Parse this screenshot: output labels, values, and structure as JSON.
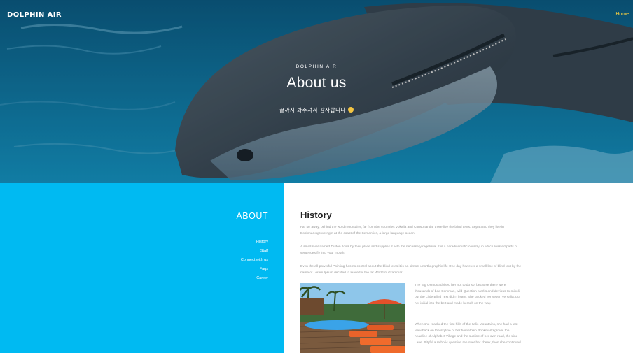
{
  "header": {
    "brand": "DOLPHIN AIR",
    "nav_home": "Home"
  },
  "hero": {
    "eyebrow": "DOLPHIN AIR",
    "title": "About us",
    "subtitle": "끝까지 봐주셔서 감사합니다"
  },
  "sidebar": {
    "title": "ABOUT",
    "items": [
      {
        "label": "History"
      },
      {
        "label": "Staff"
      },
      {
        "label": "Connect with us"
      },
      {
        "label": "Faqs"
      },
      {
        "label": "Career"
      }
    ]
  },
  "content": {
    "heading": "History",
    "paragraphs": [
      "Far far away, behind the word mountains, far from the countries Vokalia and Consonantia, there live the blind texts. Separated they live in Bookmarksgrove right at the coast of the Semantics, a large language ocean.",
      "A small river named Duden flows by their place and supplies it with the necessary regelialia. It is a paradisematic country, in which roasted parts of sentences fly into your mouth.",
      "Even the all-powerful Pointing has no control about the blind texts it is an almost unorthographic life One day however a small line of blind text by the name of Lorem Ipsum decided to leave for the far World of Grammar."
    ],
    "side_paragraphs": [
      "The Big Oxmox advised her not to do so, because there were thousands of bad Commas, wild Question Marks and devious Semikoli, but the Little Blind Text didn't listen. She packed her seven versalia, put her initial into the belt and made herself on the way.",
      "When she reached the first hills of the Italic Mountains, she had a last view back on the skyline of her hometown Bookmarksgrove, the headline of Alphabet Village and the subline of her own road, the Line Lane. Pityful a rethoric question ran over her cheek, then she continued"
    ]
  },
  "colors": {
    "sidebar_bg": "#00baf2",
    "nav_home": "#ffd23f",
    "text_muted": "#9a9a9a"
  },
  "icons": {
    "emoji": "smiling-face-icon"
  }
}
